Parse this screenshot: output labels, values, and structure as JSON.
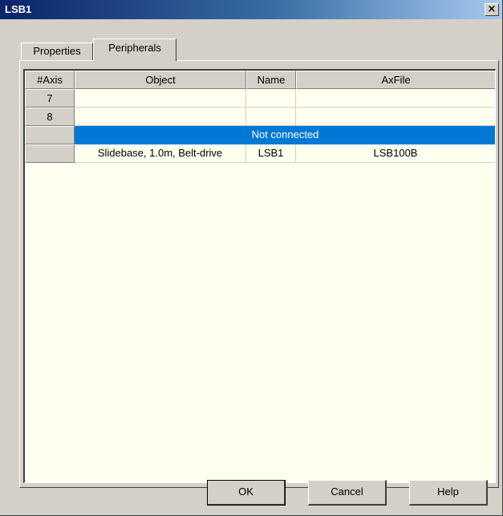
{
  "window": {
    "title": "LSB1",
    "close_glyph": "×"
  },
  "tabs": [
    {
      "label": "Properties",
      "active": false
    },
    {
      "label": "Peripherals",
      "active": true
    }
  ],
  "table": {
    "columns": [
      "#Axis",
      "Object",
      "Name",
      "AxFile"
    ],
    "rows": [
      {
        "axis": "7",
        "object": "",
        "name": "",
        "axfile": ""
      },
      {
        "axis": "8",
        "object": "",
        "name": "",
        "axfile": ""
      },
      {
        "axis": "",
        "status": "Not connected",
        "selected": true
      },
      {
        "axis": "",
        "object": "Slidebase, 1.0m, Belt-drive",
        "name": "LSB1",
        "axfile": "LSB100B"
      }
    ]
  },
  "buttons": {
    "ok": "OK",
    "cancel": "Cancel",
    "help": "Help"
  },
  "colors": {
    "selection": "#0078d4",
    "grid_background": "#fffff0",
    "titlebar": "#0a246a"
  }
}
